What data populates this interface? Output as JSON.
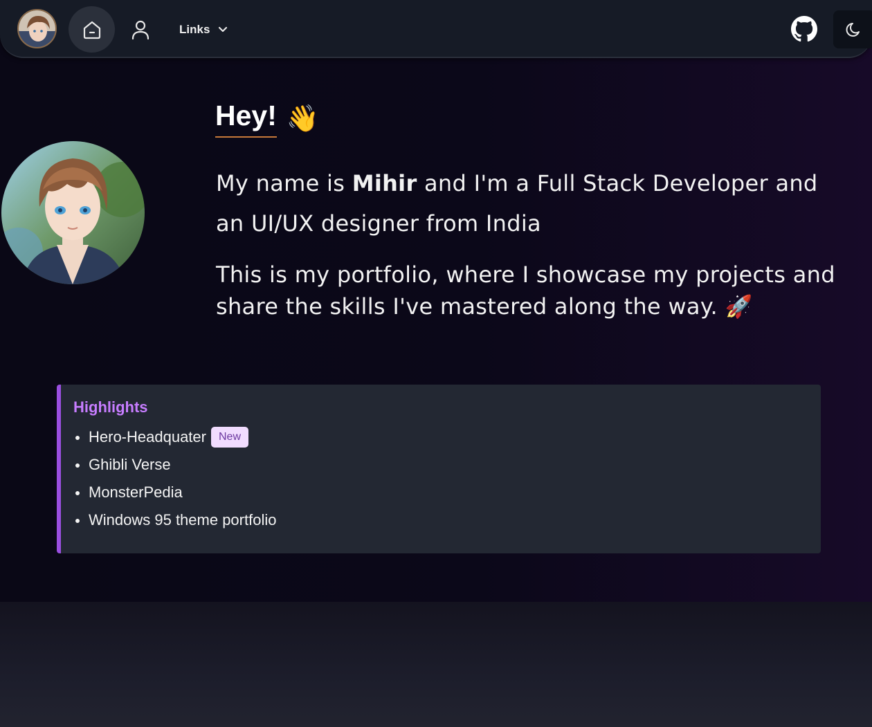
{
  "nav": {
    "links_label": "Links",
    "avatar_icon": "avatar",
    "home_icon": "home-icon",
    "user_icon": "user-icon",
    "github_icon": "github-icon",
    "theme_icon": "moon-icon"
  },
  "intro": {
    "greeting": "Hey!",
    "greeting_emoji": "👋",
    "line1_prefix": "My name is ",
    "name": "Mihir",
    "line1_suffix": " and I'm a Full Stack Developer and an UI/UX designer from India",
    "line2": "This is my portfolio, where I showcase my projects and share the skills I've mastered along the way.",
    "line2_emoji": "🚀"
  },
  "highlights": {
    "title": "Highlights",
    "items": [
      {
        "label": "Hero-Headquater",
        "badge": "New"
      },
      {
        "label": "Ghibli Verse"
      },
      {
        "label": "MonsterPedia"
      },
      {
        "label": "Windows 95 theme portfolio"
      }
    ]
  },
  "colors": {
    "accent": "#c77dff",
    "accent_border": "#9a4fe0",
    "underline": "#c7793a",
    "badge_bg": "#f1dcff",
    "badge_text": "#6d3aa1"
  }
}
